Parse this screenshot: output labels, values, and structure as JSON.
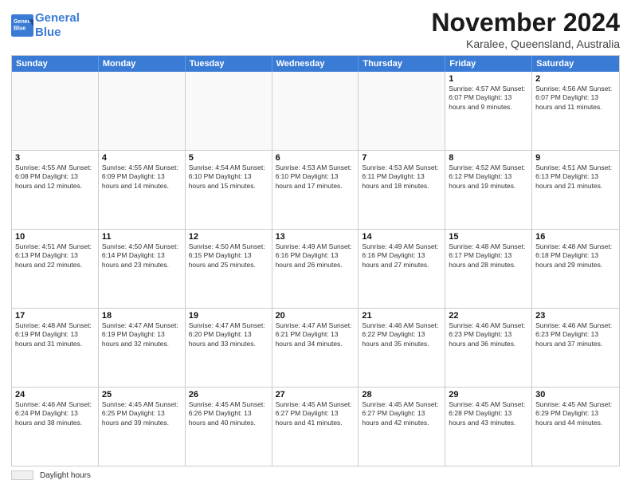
{
  "header": {
    "logo_line1": "General",
    "logo_line2": "Blue",
    "month_title": "November 2024",
    "location": "Karalee, Queensland, Australia"
  },
  "calendar": {
    "days_of_week": [
      "Sunday",
      "Monday",
      "Tuesday",
      "Wednesday",
      "Thursday",
      "Friday",
      "Saturday"
    ],
    "weeks": [
      [
        {
          "day": "",
          "info": "",
          "empty": true
        },
        {
          "day": "",
          "info": "",
          "empty": true
        },
        {
          "day": "",
          "info": "",
          "empty": true
        },
        {
          "day": "",
          "info": "",
          "empty": true
        },
        {
          "day": "",
          "info": "",
          "empty": true
        },
        {
          "day": "1",
          "info": "Sunrise: 4:57 AM\nSunset: 6:07 PM\nDaylight: 13 hours\nand 9 minutes."
        },
        {
          "day": "2",
          "info": "Sunrise: 4:56 AM\nSunset: 6:07 PM\nDaylight: 13 hours\nand 11 minutes."
        }
      ],
      [
        {
          "day": "3",
          "info": "Sunrise: 4:55 AM\nSunset: 6:08 PM\nDaylight: 13 hours\nand 12 minutes."
        },
        {
          "day": "4",
          "info": "Sunrise: 4:55 AM\nSunset: 6:09 PM\nDaylight: 13 hours\nand 14 minutes."
        },
        {
          "day": "5",
          "info": "Sunrise: 4:54 AM\nSunset: 6:10 PM\nDaylight: 13 hours\nand 15 minutes."
        },
        {
          "day": "6",
          "info": "Sunrise: 4:53 AM\nSunset: 6:10 PM\nDaylight: 13 hours\nand 17 minutes."
        },
        {
          "day": "7",
          "info": "Sunrise: 4:53 AM\nSunset: 6:11 PM\nDaylight: 13 hours\nand 18 minutes."
        },
        {
          "day": "8",
          "info": "Sunrise: 4:52 AM\nSunset: 6:12 PM\nDaylight: 13 hours\nand 19 minutes."
        },
        {
          "day": "9",
          "info": "Sunrise: 4:51 AM\nSunset: 6:13 PM\nDaylight: 13 hours\nand 21 minutes."
        }
      ],
      [
        {
          "day": "10",
          "info": "Sunrise: 4:51 AM\nSunset: 6:13 PM\nDaylight: 13 hours\nand 22 minutes."
        },
        {
          "day": "11",
          "info": "Sunrise: 4:50 AM\nSunset: 6:14 PM\nDaylight: 13 hours\nand 23 minutes."
        },
        {
          "day": "12",
          "info": "Sunrise: 4:50 AM\nSunset: 6:15 PM\nDaylight: 13 hours\nand 25 minutes."
        },
        {
          "day": "13",
          "info": "Sunrise: 4:49 AM\nSunset: 6:16 PM\nDaylight: 13 hours\nand 26 minutes."
        },
        {
          "day": "14",
          "info": "Sunrise: 4:49 AM\nSunset: 6:16 PM\nDaylight: 13 hours\nand 27 minutes."
        },
        {
          "day": "15",
          "info": "Sunrise: 4:48 AM\nSunset: 6:17 PM\nDaylight: 13 hours\nand 28 minutes."
        },
        {
          "day": "16",
          "info": "Sunrise: 4:48 AM\nSunset: 6:18 PM\nDaylight: 13 hours\nand 29 minutes."
        }
      ],
      [
        {
          "day": "17",
          "info": "Sunrise: 4:48 AM\nSunset: 6:19 PM\nDaylight: 13 hours\nand 31 minutes."
        },
        {
          "day": "18",
          "info": "Sunrise: 4:47 AM\nSunset: 6:19 PM\nDaylight: 13 hours\nand 32 minutes."
        },
        {
          "day": "19",
          "info": "Sunrise: 4:47 AM\nSunset: 6:20 PM\nDaylight: 13 hours\nand 33 minutes."
        },
        {
          "day": "20",
          "info": "Sunrise: 4:47 AM\nSunset: 6:21 PM\nDaylight: 13 hours\nand 34 minutes."
        },
        {
          "day": "21",
          "info": "Sunrise: 4:46 AM\nSunset: 6:22 PM\nDaylight: 13 hours\nand 35 minutes."
        },
        {
          "day": "22",
          "info": "Sunrise: 4:46 AM\nSunset: 6:23 PM\nDaylight: 13 hours\nand 36 minutes."
        },
        {
          "day": "23",
          "info": "Sunrise: 4:46 AM\nSunset: 6:23 PM\nDaylight: 13 hours\nand 37 minutes."
        }
      ],
      [
        {
          "day": "24",
          "info": "Sunrise: 4:46 AM\nSunset: 6:24 PM\nDaylight: 13 hours\nand 38 minutes."
        },
        {
          "day": "25",
          "info": "Sunrise: 4:45 AM\nSunset: 6:25 PM\nDaylight: 13 hours\nand 39 minutes."
        },
        {
          "day": "26",
          "info": "Sunrise: 4:45 AM\nSunset: 6:26 PM\nDaylight: 13 hours\nand 40 minutes."
        },
        {
          "day": "27",
          "info": "Sunrise: 4:45 AM\nSunset: 6:27 PM\nDaylight: 13 hours\nand 41 minutes."
        },
        {
          "day": "28",
          "info": "Sunrise: 4:45 AM\nSunset: 6:27 PM\nDaylight: 13 hours\nand 42 minutes."
        },
        {
          "day": "29",
          "info": "Sunrise: 4:45 AM\nSunset: 6:28 PM\nDaylight: 13 hours\nand 43 minutes."
        },
        {
          "day": "30",
          "info": "Sunrise: 4:45 AM\nSunset: 6:29 PM\nDaylight: 13 hours\nand 44 minutes."
        }
      ]
    ]
  },
  "legend": {
    "shaded_label": "Daylight hours"
  }
}
